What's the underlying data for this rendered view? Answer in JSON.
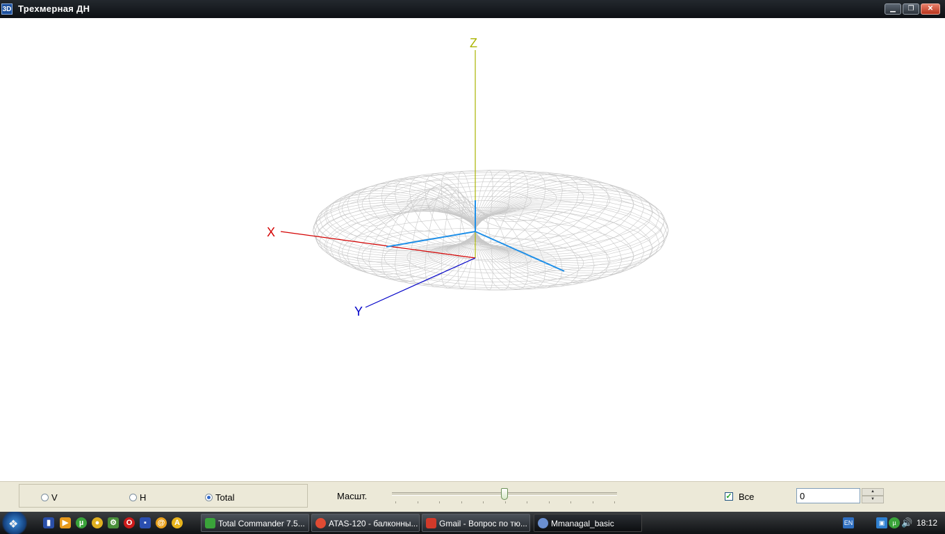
{
  "window": {
    "icon_text": "3D",
    "title": "Трехмерная ДН"
  },
  "axes": {
    "x_label": "X",
    "y_label": "Y",
    "z_label": "Z"
  },
  "controls": {
    "radios": [
      {
        "label": "V",
        "selected": false
      },
      {
        "label": "H",
        "selected": false
      },
      {
        "label": "Total",
        "selected": true
      }
    ],
    "scale_label": "Масшт.",
    "scale_slider_value": 0.5,
    "all_checkbox": {
      "label": "Все",
      "checked": true
    },
    "spin_value": "0"
  },
  "taskbar": {
    "tasks": [
      {
        "label": "Total Commander 7.5...",
        "icon": "floppy-icon",
        "color": "#3aa33a"
      },
      {
        "label": "ATAS-120 - балконны...",
        "icon": "chrome-icon",
        "color": "#e04b33"
      },
      {
        "label": "Gmail - Вопрос по тю...",
        "icon": "gmail-icon",
        "color": "#d23a2a"
      },
      {
        "label": "Mmanagal_basic",
        "icon": "app-icon",
        "color": "#6a8fd0"
      }
    ],
    "tray": {
      "lang": "EN"
    },
    "clock": "18:12"
  },
  "colors": {
    "mesh": "#c8c8c8",
    "x_axis": "#d40000",
    "y_axis": "#0000c8",
    "z_axis": "#aab400",
    "ref_axes": "#1e8fe8"
  }
}
